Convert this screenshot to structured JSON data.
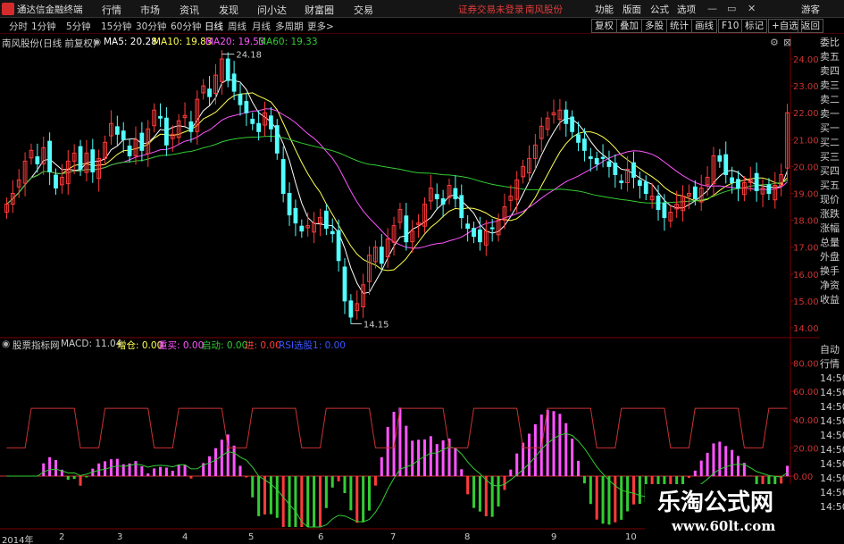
{
  "menubar": {
    "app_title": "通达信金融终端",
    "menus": [
      "行情",
      "市场",
      "资讯",
      "发现",
      "问小达",
      "财富圈",
      "交易"
    ],
    "notice": "证券交易未登录",
    "stock_link": "南风股份",
    "right_menus": [
      "功能",
      "版面",
      "公式",
      "选项"
    ],
    "guest": "游客"
  },
  "periods": [
    "分时",
    "1分钟",
    "5分钟",
    "15分钟",
    "30分钟",
    "60分钟",
    "日线",
    "周线",
    "月线",
    "多周期",
    "更多>"
  ],
  "active_period": "日线",
  "toolbar": [
    "复权",
    "叠加",
    "多股",
    "统计",
    "画线",
    "F10",
    "标记",
    "+自选",
    "返回"
  ],
  "main_info": {
    "stock": "南风股份(日线 前复权)",
    "ma5": "MA5: 20.28",
    "ma10": "MA10: 19.83",
    "ma20": "MA20: 19.53",
    "ma60": "MA60: 19.33"
  },
  "price_axis": [
    "24.00",
    "23.00",
    "22.00",
    "21.00",
    "20.00",
    "19.00",
    "18.00",
    "17.00",
    "16.00",
    "15.00",
    "14.00"
  ],
  "annotations": {
    "high": "24.18",
    "low": "14.15"
  },
  "side_labels": [
    "委比",
    "卖五",
    "卖四",
    "卖三",
    "卖二",
    "卖一",
    "买一",
    "买二",
    "买三",
    "买四",
    "买五",
    "现价",
    "涨跌",
    "涨幅",
    "总量",
    "外盘",
    "换手",
    "净资",
    "收益"
  ],
  "sub_info": {
    "name": "股票指标网",
    "macd": "MACD: 11.04",
    "zc": "增仓: 0.00",
    "lm": "重买: 0.00",
    "qd": "启动: 0.00",
    "jn": "进: 0.00",
    "rsi": "RSI选股1: 0.00"
  },
  "sub_axis": [
    "80.00",
    "60.00",
    "40.00",
    "20.00",
    "0.00"
  ],
  "sub_side_labels": [
    "自动",
    "行情",
    "14:50",
    "14:50",
    "14:50",
    "14:50",
    "14:50",
    "14:50",
    "14:50",
    "14:50",
    "14:50",
    "14:50"
  ],
  "dates": [
    "2014年",
    "2",
    "3",
    "4",
    "5",
    "6",
    "7",
    "8",
    "9",
    "10"
  ],
  "watermark": {
    "title": "乐淘公式网",
    "url": "www.60lt.com"
  },
  "colors": {
    "up": "#ff3b3b",
    "down": "#54ffff",
    "ma5": "#ffffff",
    "ma10": "#ffff55",
    "ma20": "#ff55ff",
    "ma60": "#33cc33",
    "macd_pos": "#ff55ff",
    "macd_neg": "#33cc33",
    "red_line": "#cc3333"
  },
  "chart_data": {
    "type": "candlestick",
    "price_range": [
      13.7,
      24.3
    ],
    "closes": [
      18.6,
      19.0,
      19.5,
      20.2,
      20.6,
      20.1,
      20.7,
      19.8,
      19.2,
      19.6,
      20.2,
      20.5,
      19.9,
      20.5,
      19.8,
      20.3,
      20.9,
      21.6,
      21.2,
      21.0,
      20.4,
      21.0,
      20.6,
      21.4,
      22.1,
      21.8,
      20.8,
      21.2,
      21.7,
      21.9,
      21.3,
      22.5,
      23.0,
      22.6,
      23.4,
      24.0,
      23.2,
      22.8,
      22.3,
      22.0,
      21.6,
      21.3,
      22.0,
      21.4,
      20.5,
      19.0,
      18.2,
      17.9,
      17.6,
      17.8,
      17.9,
      18.1,
      17.7,
      17.5,
      16.5,
      15.0,
      14.4,
      14.9,
      15.6,
      16.7,
      17.0,
      16.4,
      17.3,
      17.8,
      18.4,
      17.2,
      17.6,
      17.9,
      18.6,
      19.2,
      18.8,
      18.6,
      19.3,
      18.8,
      18.1,
      17.7,
      17.4,
      17.2,
      17.6,
      17.7,
      18.0,
      18.5,
      18.9,
      19.5,
      20.0,
      20.3,
      20.8,
      21.5,
      21.8,
      22.0,
      22.1,
      21.6,
      21.3,
      20.9,
      20.6,
      20.3,
      20.1,
      20.3,
      20.0,
      19.7,
      19.4,
      19.9,
      19.6,
      19.3,
      19.0,
      18.9,
      18.4,
      18.1,
      18.3,
      18.6,
      18.9,
      19.0,
      18.8,
      19.2,
      19.6,
      20.4,
      20.2,
      19.7,
      19.4,
      19.2,
      19.4,
      19.5,
      19.1,
      19.2,
      19.0,
      19.3,
      19.7,
      22.0
    ],
    "macd_range": [
      -36,
      86
    ]
  }
}
